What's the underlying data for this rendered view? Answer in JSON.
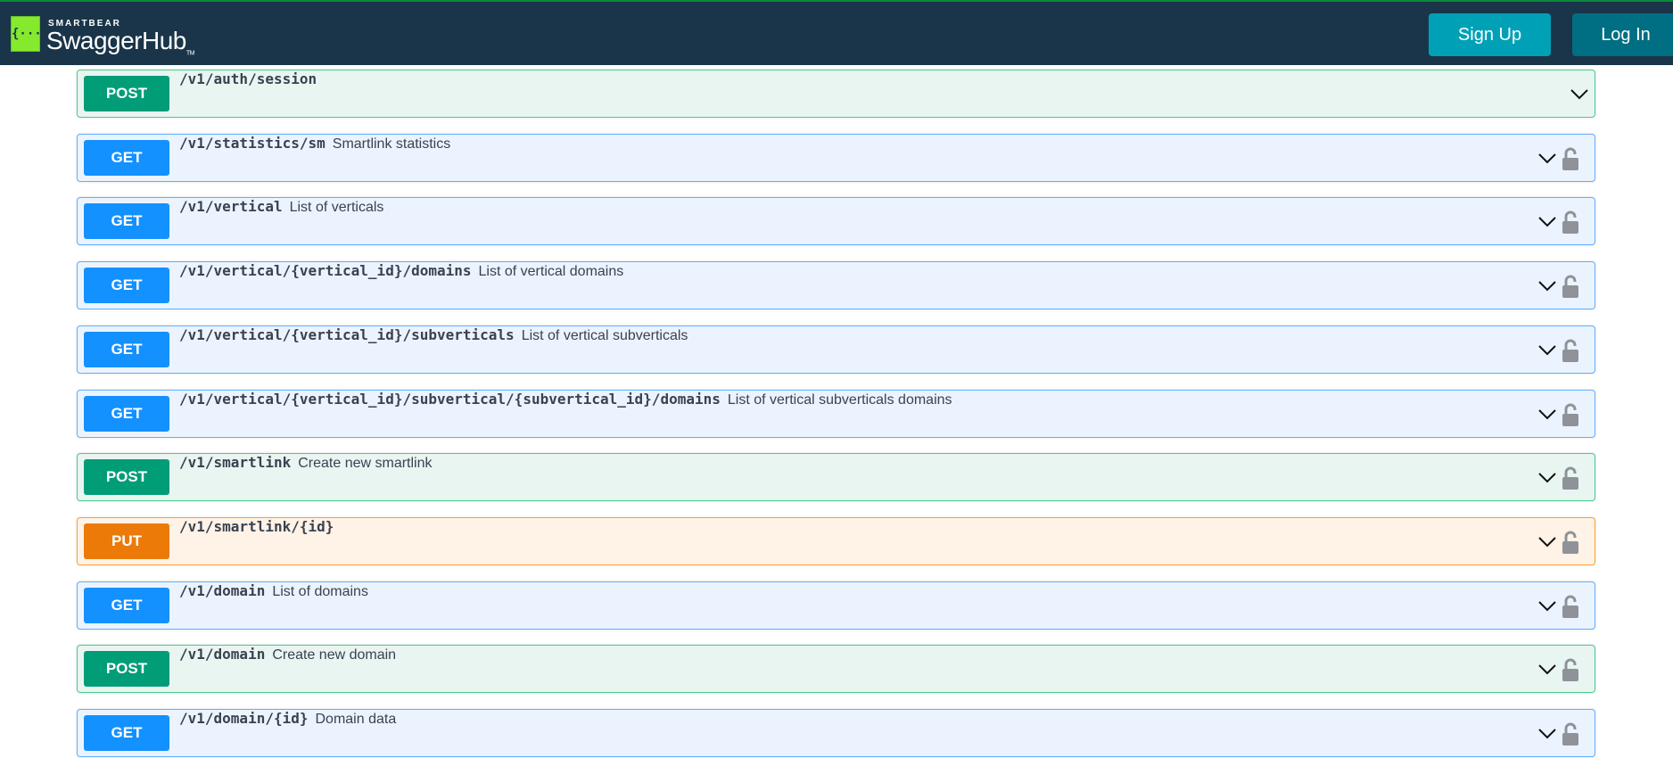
{
  "header": {
    "brand_small": "SMARTBEAR",
    "brand": "SwaggerHub",
    "trademark": "TM",
    "logo_glyph": "{···}",
    "signup": "Sign Up",
    "login": "Log In"
  },
  "colors": {
    "get": "#1391ff",
    "post": "#009d77",
    "put": "#ec7a08",
    "header": "#1a3549"
  },
  "operations": [
    {
      "method": "POST",
      "path": "/v1/auth/session",
      "desc": "",
      "locked": false
    },
    {
      "method": "GET",
      "path": "/v1/statistics/sm",
      "desc": "Smartlink statistics",
      "locked": true
    },
    {
      "method": "GET",
      "path": "/v1/vertical",
      "desc": "List of verticals",
      "locked": true
    },
    {
      "method": "GET",
      "path": "/v1/vertical/{vertical_id}/domains",
      "desc": "List of vertical domains",
      "locked": true
    },
    {
      "method": "GET",
      "path": "/v1/vertical/{vertical_id}/subverticals",
      "desc": "List of vertical subverticals",
      "locked": true
    },
    {
      "method": "GET",
      "path": "/v1/vertical/{vertical_id}/subvertical/{subvertical_id}/domains",
      "desc": "List of vertical subverticals domains",
      "locked": true
    },
    {
      "method": "POST",
      "path": "/v1/smartlink",
      "desc": "Create new smartlink",
      "locked": true
    },
    {
      "method": "PUT",
      "path": "/v1/smartlink/{id}",
      "desc": "",
      "locked": true
    },
    {
      "method": "GET",
      "path": "/v1/domain",
      "desc": "List of domains",
      "locked": true
    },
    {
      "method": "POST",
      "path": "/v1/domain",
      "desc": "Create new domain",
      "locked": true
    },
    {
      "method": "GET",
      "path": "/v1/domain/{id}",
      "desc": "Domain data",
      "locked": true
    }
  ]
}
